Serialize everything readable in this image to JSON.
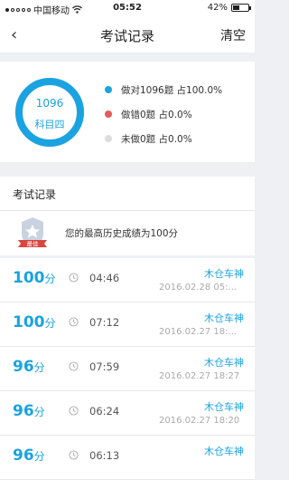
{
  "status_bar": {
    "carrier": "中国移动",
    "time": "05:52",
    "battery_text": "42%",
    "battery_level": 0.42
  },
  "nav": {
    "back_glyph": "‹",
    "title": "考试记录",
    "clear_label": "清空"
  },
  "stats": {
    "total": "1096",
    "subject": "科目四",
    "chart_colors": {
      "correct": "#1aa3e0",
      "wrong": "#e35b5b",
      "undone": "#dddddd"
    },
    "legend": [
      {
        "label": "做对1096题 占100.0%",
        "color": "#1aa3e0"
      },
      {
        "label": "做错0题 占0.0%",
        "color": "#e35b5b"
      },
      {
        "label": "未做0题 占0.0%",
        "color": "#dddddd"
      }
    ]
  },
  "records": {
    "title": "考试记录",
    "best_badge": "最佳",
    "best_text": "您的最高历史成绩为100分",
    "items": [
      {
        "score": "100",
        "unit": "分",
        "duration": "04:46",
        "name": "木仓车神",
        "date": "2016.02.28 05:..."
      },
      {
        "score": "100",
        "unit": "分",
        "duration": "07:12",
        "name": "木仓车神",
        "date": "2016.02.27 18:..."
      },
      {
        "score": "96",
        "unit": "分",
        "duration": "07:59",
        "name": "木仓车神",
        "date": "2016.02.27 18:27"
      },
      {
        "score": "96",
        "unit": "分",
        "duration": "06:24",
        "name": "木仓车神",
        "date": "2016.02.27 18:20"
      },
      {
        "score": "96",
        "unit": "分",
        "duration": "06:13",
        "name": "木仓车神",
        "date": ""
      }
    ]
  }
}
